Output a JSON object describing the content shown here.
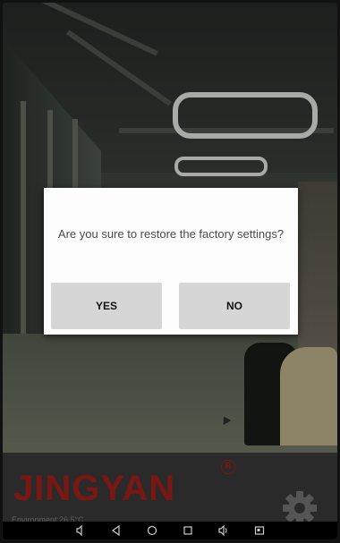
{
  "dialog": {
    "message": "Are you sure to restore the factory settings?",
    "yes_label": "YES",
    "no_label": "NO"
  },
  "brand": {
    "logo_text": "JINGYAN",
    "registered_mark": "R",
    "color": "#7a1713"
  },
  "status": {
    "environment": "Environment:26.5°C"
  },
  "icons": {
    "settings": "gear-icon",
    "nav": [
      "volume-down-icon",
      "back-icon",
      "home-icon",
      "recents-icon",
      "volume-up-icon",
      "screenshot-icon"
    ]
  }
}
